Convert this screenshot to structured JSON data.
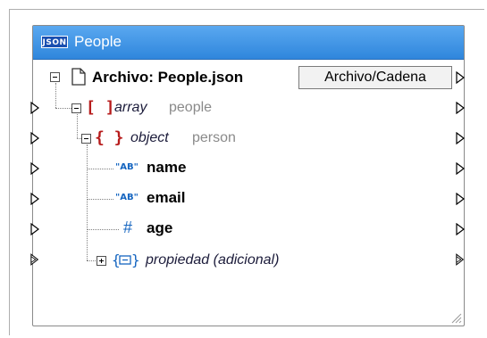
{
  "component": {
    "title": "People",
    "title_icon": "json-icon",
    "root": {
      "label": "Archivo: People.json",
      "button_label": "Archivo/Cadena"
    },
    "array_node": {
      "type": "[ ]",
      "kind": "array",
      "name": "people"
    },
    "object_node": {
      "type": "{ }",
      "kind": "object",
      "name": "person"
    },
    "fields": [
      {
        "badge": "\"AB\"",
        "name": "name"
      },
      {
        "badge": "\"AB\"",
        "name": "email"
      },
      {
        "badge": "#",
        "name": "age"
      }
    ],
    "additional": {
      "label": "propiedad (adicional)"
    }
  },
  "colors": {
    "title_bar": "#2f86dc",
    "type_brackets": "#b71c1c",
    "string_badge": "#1565c0"
  },
  "json_badge_text": "JSON"
}
